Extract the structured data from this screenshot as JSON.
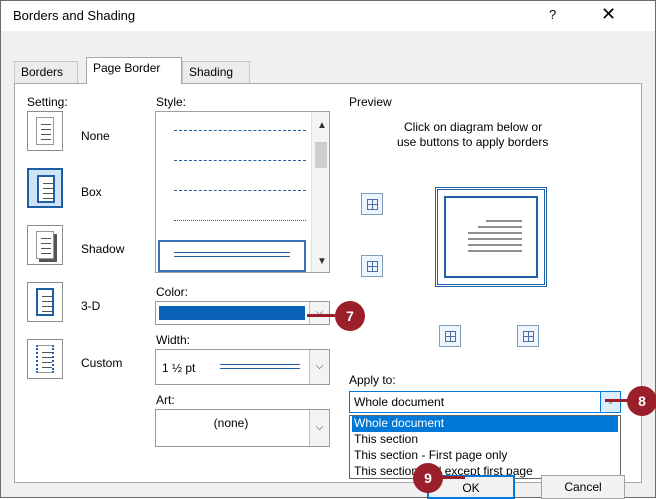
{
  "window": {
    "title": "Borders and Shading",
    "help": "?",
    "close": "✕"
  },
  "tabs": [
    {
      "label": "Borders"
    },
    {
      "label": "Page Border"
    },
    {
      "label": "Shading"
    }
  ],
  "setting": {
    "label": "Setting:",
    "items": [
      {
        "label": "None"
      },
      {
        "label": "Box"
      },
      {
        "label": "Shadow"
      },
      {
        "label": "3-D"
      },
      {
        "label": "Custom"
      }
    ]
  },
  "style": {
    "label": "Style:"
  },
  "color": {
    "label": "Color:",
    "value": "#0a62b7"
  },
  "width": {
    "label": "Width:",
    "value": "1 ½ pt"
  },
  "art": {
    "label": "Art:",
    "value": "(none)"
  },
  "preview": {
    "label": "Preview",
    "instructions_line1": "Click on diagram below or",
    "instructions_line2": "use buttons to apply borders"
  },
  "apply_to": {
    "label": "Apply to:",
    "value": "Whole document",
    "options": [
      "Whole document",
      "This section",
      "This section - First page only",
      "This section - All except first page"
    ]
  },
  "buttons": {
    "ok": "OK",
    "cancel": "Cancel"
  },
  "callouts": {
    "seven": "7",
    "eight": "8",
    "nine": "9"
  },
  "colors": {
    "accent": "#0078d7",
    "border_blue": "#1f5fa8",
    "callout": "#9b1f2b"
  }
}
